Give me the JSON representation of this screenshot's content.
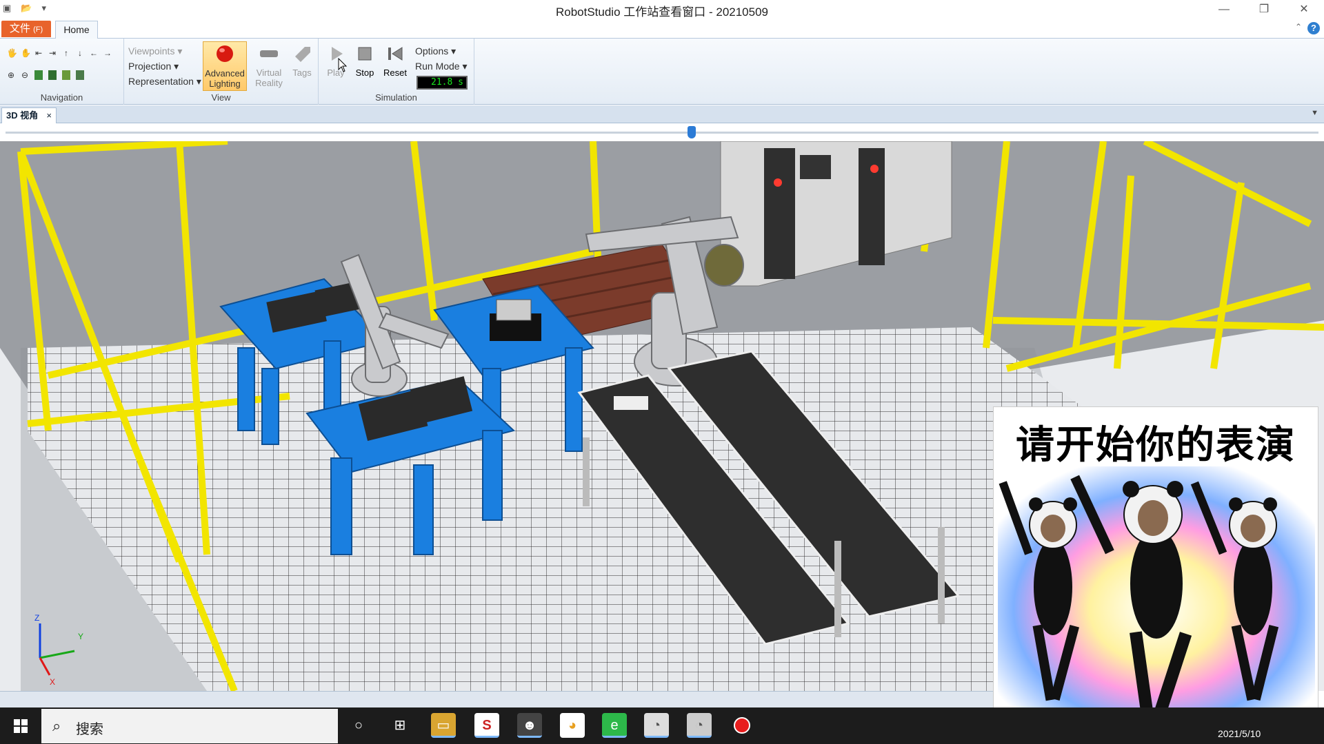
{
  "window": {
    "title": "RobotStudio 工作站查看窗口 - 20210509",
    "minimize": "—",
    "restore": "❐",
    "close": "✕"
  },
  "ribbon_tabs": {
    "file_label": "文件",
    "file_hotkey": "(F)",
    "home_label": "Home"
  },
  "navigation": {
    "label": "Navigation"
  },
  "view": {
    "label": "View",
    "viewpoints": "Viewpoints",
    "projection": "Projection",
    "representation": "Representation",
    "advanced_line1": "Advanced",
    "advanced_line2": "Lighting",
    "virtual_line1": "Virtual",
    "virtual_line2": "Reality",
    "tags": "Tags"
  },
  "simulation": {
    "label": "Simulation",
    "play": "Play",
    "stop": "Stop",
    "reset": "Reset",
    "options": "Options",
    "run_mode": "Run Mode",
    "time_display": "21.8 s"
  },
  "document_tab": {
    "label": "3D 视角",
    "close": "×"
  },
  "viewport": {
    "axis_z": "Z",
    "axis_y": "Y",
    "axis_x": "X"
  },
  "meme": {
    "caption": "请开始你的表演"
  },
  "taskbar": {
    "search_placeholder": "搜索",
    "date": "2021/5/10"
  },
  "colors": {
    "fence": "#f2e500",
    "table": "#1a7fe0",
    "conveyor": "#2e2e2e",
    "pallet": "#7b3b2b",
    "accent_file_tab": "#e8632b"
  }
}
